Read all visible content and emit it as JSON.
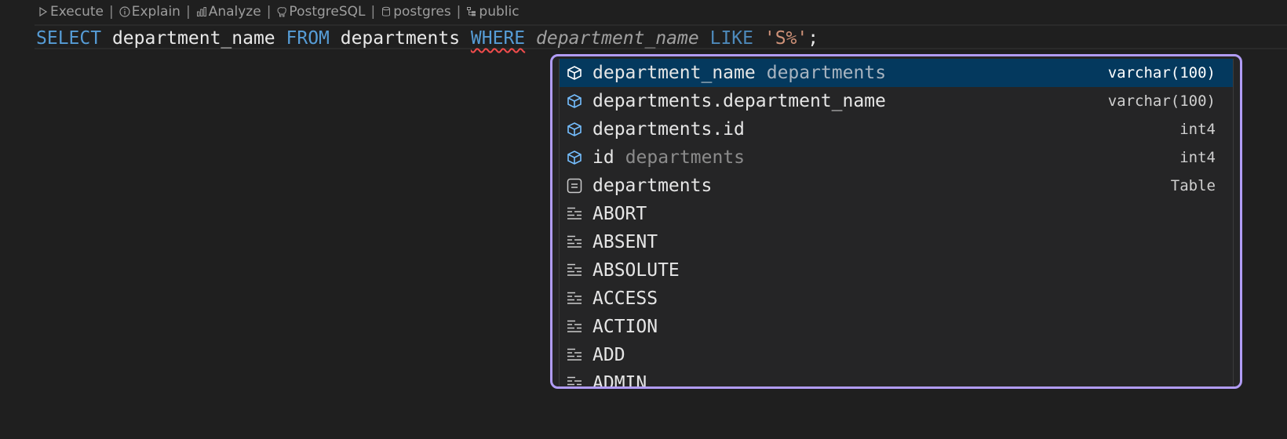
{
  "codelens": {
    "items": [
      {
        "label": "Execute",
        "icon": "play-icon"
      },
      {
        "label": "Explain",
        "icon": "info-icon"
      },
      {
        "label": "Analyze",
        "icon": "bar-chart-icon"
      },
      {
        "label": "PostgreSQL",
        "icon": "elephant-icon"
      },
      {
        "label": "postgres",
        "icon": "database-icon"
      },
      {
        "label": "public",
        "icon": "schema-icon"
      }
    ],
    "separator": "|"
  },
  "editor": {
    "tokens": {
      "select": "SELECT",
      "col": " department_name ",
      "from": "FROM",
      "table": " departments ",
      "where": "WHERE",
      "sp1": " ",
      "ghost": "department_name",
      "sp2": " ",
      "like": "LIKE",
      "sp3": " ",
      "str": "'S%'",
      "semi": ";"
    }
  },
  "suggest": {
    "selected_index": 0,
    "items": [
      {
        "label": "department_name",
        "qualifier": "departments",
        "detail": "varchar(100)",
        "kind": "field-icon"
      },
      {
        "label": "departments.department_name",
        "qualifier": "",
        "detail": "varchar(100)",
        "kind": "field-icon"
      },
      {
        "label": "departments.id",
        "qualifier": "",
        "detail": "int4",
        "kind": "field-icon"
      },
      {
        "label": "id",
        "qualifier": "departments",
        "detail": "int4",
        "kind": "field-icon"
      },
      {
        "label": "departments",
        "qualifier": "",
        "detail": "Table",
        "kind": "table-icon"
      },
      {
        "label": "ABORT",
        "qualifier": "",
        "detail": "",
        "kind": "keyword-icon"
      },
      {
        "label": "ABSENT",
        "qualifier": "",
        "detail": "",
        "kind": "keyword-icon"
      },
      {
        "label": "ABSOLUTE",
        "qualifier": "",
        "detail": "",
        "kind": "keyword-icon"
      },
      {
        "label": "ACCESS",
        "qualifier": "",
        "detail": "",
        "kind": "keyword-icon"
      },
      {
        "label": "ACTION",
        "qualifier": "",
        "detail": "",
        "kind": "keyword-icon"
      },
      {
        "label": "ADD",
        "qualifier": "",
        "detail": "",
        "kind": "keyword-icon"
      },
      {
        "label": "ADMIN",
        "qualifier": "",
        "detail": "",
        "kind": "keyword-icon"
      }
    ]
  },
  "colors": {
    "keyword": "#569cd6",
    "string": "#ce9178",
    "selection": "#04395e",
    "widget_border": "#b19cf5",
    "field_icon": "#75beff"
  }
}
